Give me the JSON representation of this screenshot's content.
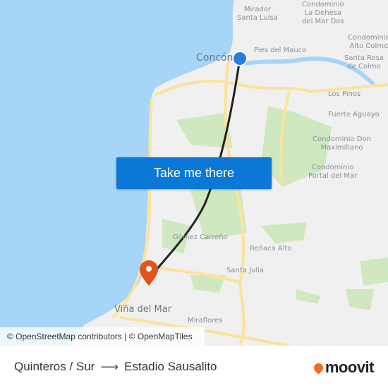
{
  "map": {
    "labels": [
      {
        "text": "Mirador\nSanta Luisa"
      },
      {
        "text": "Condominio\nLa Dehesa\ndel Mar Dos"
      },
      {
        "text": "Condominio\nAlto Colmo"
      },
      {
        "text": "Concón"
      },
      {
        "text": "Pies del Mauco"
      },
      {
        "text": "Santa Rosa\nde Colmo"
      },
      {
        "text": "Los Pinos"
      },
      {
        "text": "Fuerte Aguayo"
      },
      {
        "text": "Condominio Don\nMaximiliano"
      },
      {
        "text": "Condominio\nPortal del Mar"
      },
      {
        "text": "Gómez Carreño"
      },
      {
        "text": "Reñaca Alto"
      },
      {
        "text": "Santa Julia"
      },
      {
        "text": "Viña del Mar"
      },
      {
        "text": "Miraflores"
      }
    ],
    "colors": {
      "water": "#a6d5f7",
      "park": "#cfe8c0",
      "road": "#fbe49a",
      "route": "#222222",
      "origin": "#2a7de1",
      "destination": "#e8501c"
    },
    "cta_label": "Take me there",
    "attribution": "© OpenStreetMap contributors | © OpenMapTiles"
  },
  "footer": {
    "origin": "Quinteros / Sur",
    "arrow": "⟶",
    "destination": "Estadio Sausalito",
    "brand": "moovit"
  }
}
